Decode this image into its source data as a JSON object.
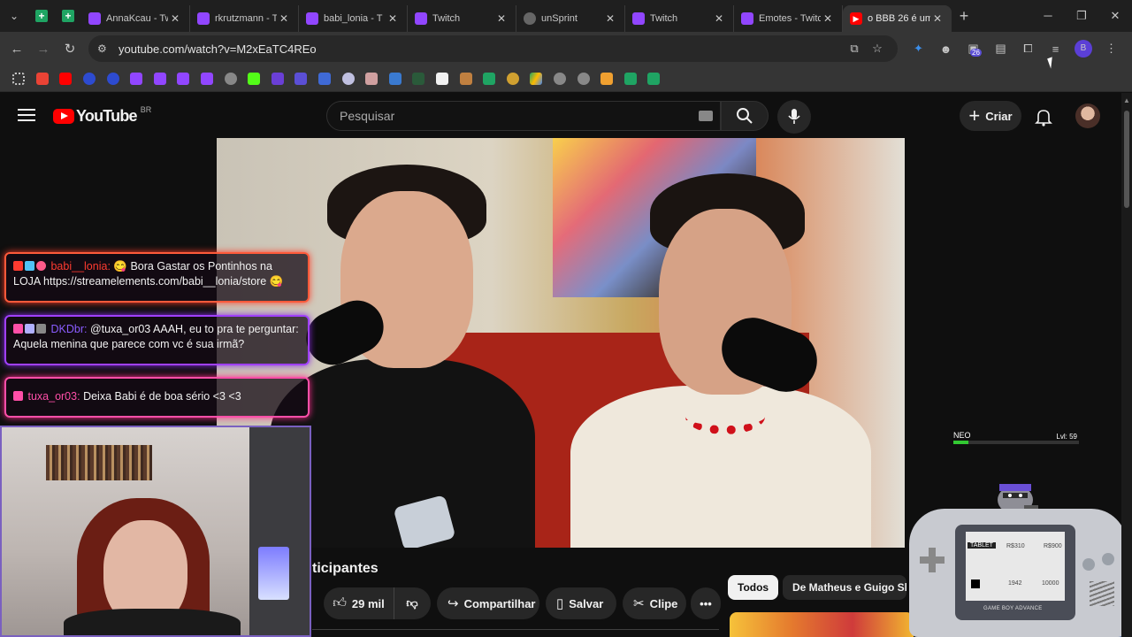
{
  "browser": {
    "tabs": [
      {
        "title": "AnnaKcau - Tw",
        "favicon": "twitch",
        "color": "#9146ff"
      },
      {
        "title": "rkrutzmann - T",
        "favicon": "twitch",
        "color": "#9146ff"
      },
      {
        "title": "babi_lonia - T",
        "favicon": "twitch",
        "color": "#9146ff"
      },
      {
        "title": "Twitch",
        "favicon": "twitch",
        "color": "#9146ff"
      },
      {
        "title": "unSprint",
        "favicon": "globe",
        "color": "#888888"
      },
      {
        "title": "Twitch",
        "favicon": "twitch",
        "color": "#9146ff"
      },
      {
        "title": "Emotes - Twitc",
        "favicon": "twitch",
        "color": "#9146ff"
      },
      {
        "title": "o BBB 26 é um",
        "favicon": "youtube",
        "color": "#ff0000",
        "active": true
      }
    ],
    "url": "youtube.com/watch?v=M2xEaTC4REo",
    "extension_badge": "26",
    "profile_initial": "B"
  },
  "youtube": {
    "logo_text": "YouTube",
    "country_code": "BR",
    "search_placeholder": "Pesquisar",
    "create_label": "Criar",
    "title_fragment": "ticipantes",
    "likes": "29 mil",
    "share_label": "Compartilhar",
    "save_label": "Salvar",
    "clip_label": "Clipe",
    "chips": [
      "Todos",
      "De Matheus e Guigo Sho"
    ]
  },
  "chat": [
    {
      "user": "babi__lonia",
      "message": "😋 Bora Gastar os Pontinhos na LOJA https://streamelements.com/babi__lonia/store 😋",
      "color": "#ff3b30"
    },
    {
      "user": "DKDbr",
      "message": "@tuxa_or03 AAAH, eu to pra te perguntar: Aquela menina que parece com vc é sua irmã?",
      "color": "#8a5cff"
    },
    {
      "user": "tuxa_or03",
      "message": "Deixa Babi é de boa sério <3 <3",
      "color": "#ff4fa8"
    }
  ],
  "overlay": {
    "pet_name": "NEO",
    "level": "Lvl: 59",
    "xp_progress": 0.12,
    "gba_labels": {
      "tablet": "TABLET",
      "price1": "R$310",
      "price2": "R$900",
      "value1": "1942",
      "value2": "10000",
      "brand": "GAME BOY ADVANCE"
    }
  }
}
